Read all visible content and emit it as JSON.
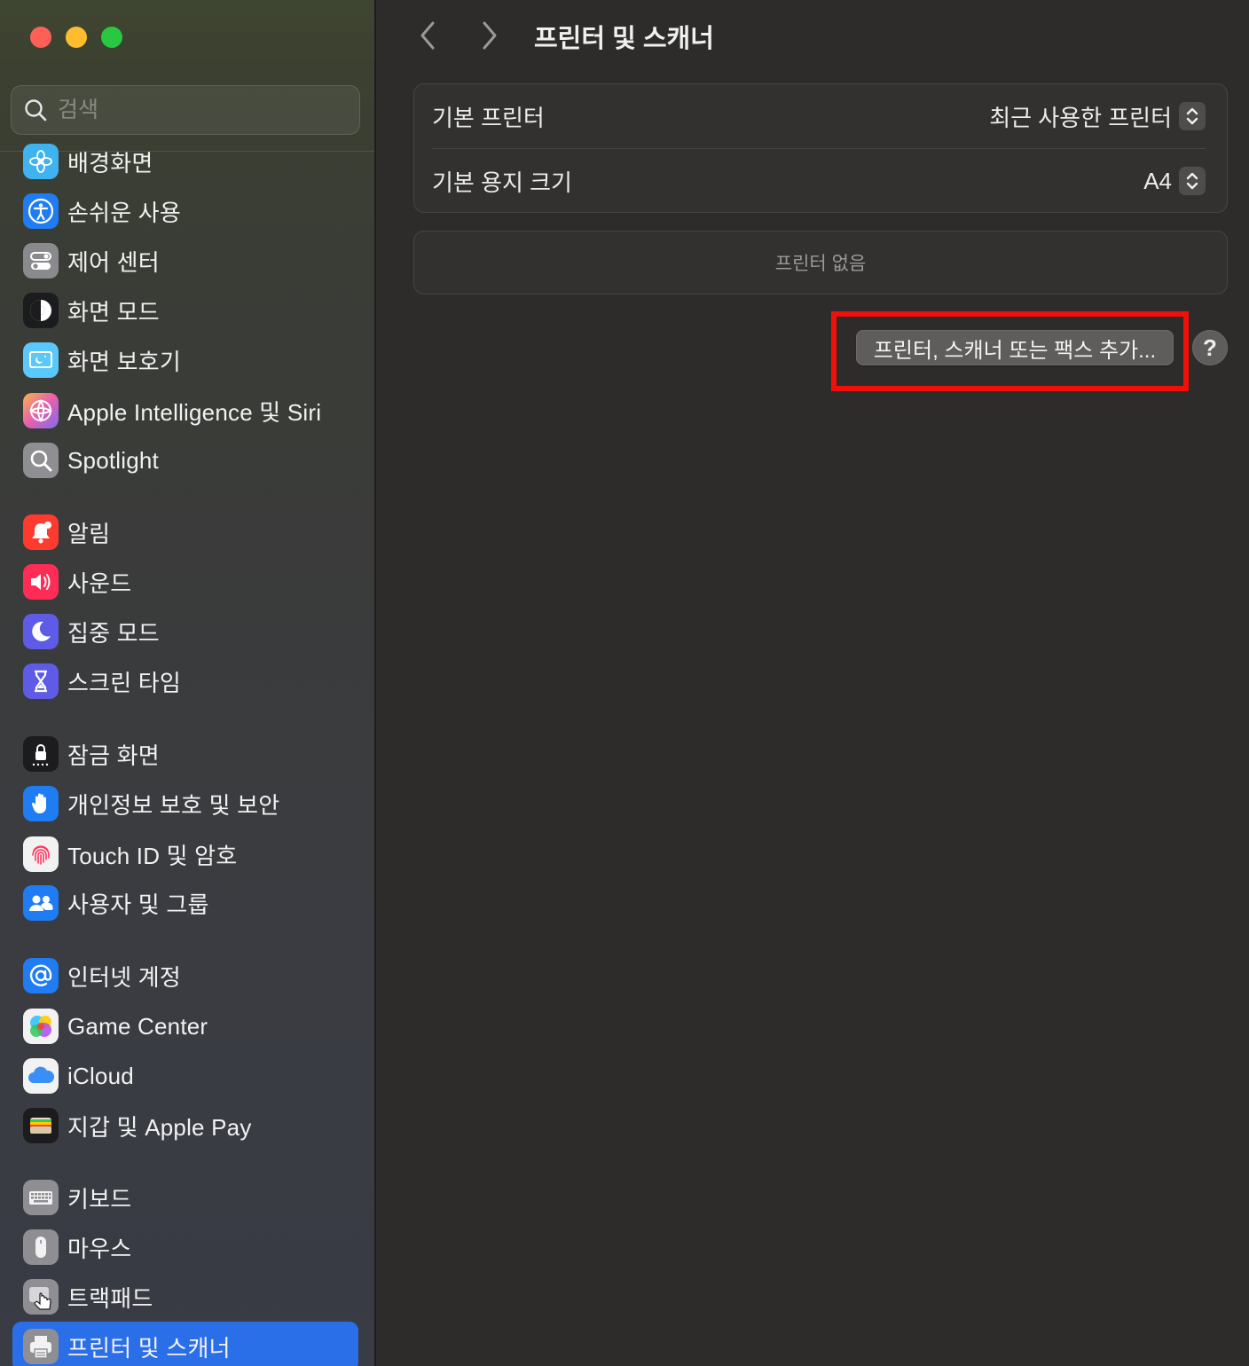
{
  "window": {
    "title": "프린터 및 스캐너"
  },
  "search": {
    "placeholder": "검색"
  },
  "sidebar": {
    "items": [
      {
        "label": "배경화면",
        "icon": "wallpaper-icon",
        "color": "#3fb3f0"
      },
      {
        "label": "손쉬운 사용",
        "icon": "accessibility-icon",
        "color": "#1f7cf2"
      },
      {
        "label": "제어 센터",
        "icon": "control-center-icon",
        "color": "#8a8a8e"
      },
      {
        "label": "화면 모드",
        "icon": "appearance-icon",
        "color": "#1c1c1e"
      },
      {
        "label": "화면 보호기",
        "icon": "screen-saver-icon",
        "color": "#5ac8fa"
      },
      {
        "label": "Apple Intelligence 및 Siri",
        "icon": "siri-icon",
        "color": "#e85fb0"
      },
      {
        "label": "Spotlight",
        "icon": "spotlight-icon",
        "color": "#8e8e93"
      },
      {
        "label": "알림",
        "icon": "notifications-icon",
        "color": "#ff3b30"
      },
      {
        "label": "사운드",
        "icon": "sound-icon",
        "color": "#ff2d55"
      },
      {
        "label": "집중 모드",
        "icon": "focus-icon",
        "color": "#5e5ce6"
      },
      {
        "label": "스크린 타임",
        "icon": "screen-time-icon",
        "color": "#5e5ce6"
      },
      {
        "label": "잠금 화면",
        "icon": "lock-screen-icon",
        "color": "#1c1c1e"
      },
      {
        "label": "개인정보 보호 및 보안",
        "icon": "privacy-hand-icon",
        "color": "#1f7cf2"
      },
      {
        "label": "Touch ID 및 암호",
        "icon": "fingerprint-icon",
        "color": "#f2f2f2"
      },
      {
        "label": "사용자 및 그룹",
        "icon": "users-icon",
        "color": "#1f7cf2"
      },
      {
        "label": "인터넷 계정",
        "icon": "internet-accounts-icon",
        "color": "#1f7cf2"
      },
      {
        "label": "Game Center",
        "icon": "game-center-icon",
        "color": "#f2f2f2"
      },
      {
        "label": "iCloud",
        "icon": "icloud-icon",
        "color": "#f2f2f2"
      },
      {
        "label": "지갑 및 Apple Pay",
        "icon": "wallet-icon",
        "color": "#1c1c1e"
      },
      {
        "label": "키보드",
        "icon": "keyboard-icon",
        "color": "#8e8e93"
      },
      {
        "label": "마우스",
        "icon": "mouse-icon",
        "color": "#8e8e93"
      },
      {
        "label": "트랙패드",
        "icon": "trackpad-icon",
        "color": "#8e8e93"
      },
      {
        "label": "프린터 및 스캐너",
        "icon": "printer-icon",
        "color": "#8e8e93",
        "active": true
      }
    ]
  },
  "main": {
    "settings": {
      "default_printer_label": "기본 프린터",
      "default_printer_value": "최근 사용한 프린터",
      "default_paper_label": "기본 용지 크기",
      "default_paper_value": "A4"
    },
    "printer_list_empty": "프린터 없음",
    "add_button_label": "프린터, 스캐너 또는 팩스 추가...",
    "help_label": "?"
  },
  "colors": {
    "accent": "#2a6ee8",
    "highlight_border": "#f20f0a"
  }
}
